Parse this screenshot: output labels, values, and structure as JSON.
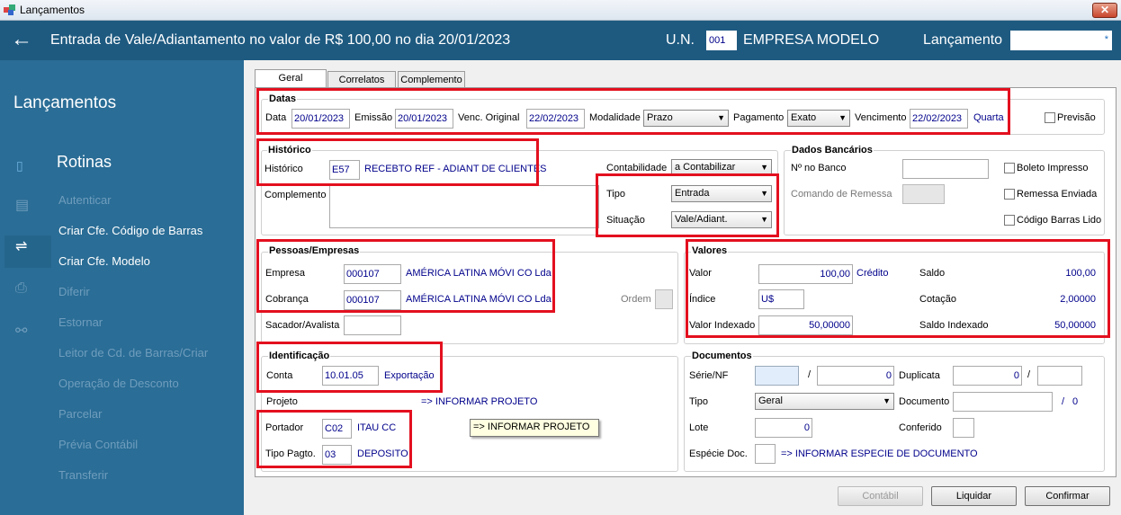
{
  "window": {
    "title": "Lançamentos",
    "close": "✕"
  },
  "header": {
    "back": "←",
    "title": "Entrada de Vale/Adiantamento no valor de R$ 100,00 no dia 20/01/2023",
    "un_label": "U.N.",
    "un_code": "001",
    "empresa": "EMPRESA MODELO",
    "lancamento_label": "Lançamento",
    "lancamento_value": "*"
  },
  "sidebar": {
    "title": "Lançamentos",
    "section": "Rotinas",
    "items": [
      {
        "label": "Autenticar",
        "enabled": false
      },
      {
        "label": "Criar Cfe. Código de Barras",
        "enabled": true
      },
      {
        "label": "Criar Cfe. Modelo",
        "enabled": true
      },
      {
        "label": "Diferir",
        "enabled": false
      },
      {
        "label": "Estornar",
        "enabled": false
      },
      {
        "label": "Leitor de Cd. de Barras/Criar",
        "enabled": false
      },
      {
        "label": "Operação de Desconto",
        "enabled": false
      },
      {
        "label": "Parcelar",
        "enabled": false
      },
      {
        "label": "Prévia Contábil",
        "enabled": false
      },
      {
        "label": "Transferir",
        "enabled": false
      }
    ]
  },
  "tabs": [
    "Geral",
    "Correlatos",
    "Complemento"
  ],
  "datas": {
    "title": "Datas",
    "data_label": "Data",
    "data": "20/01/2023",
    "emissao_label": "Emissão",
    "emissao": "20/01/2023",
    "venc_orig_label": "Venc. Original",
    "venc_orig": "22/02/2023",
    "modalidade_label": "Modalidade",
    "modalidade": "Prazo",
    "pagamento_label": "Pagamento",
    "pagamento": "Exato",
    "vencimento_label": "Vencimento",
    "vencimento": "22/02/2023",
    "dia_semana": "Quarta",
    "previsao_label": "Previsão"
  },
  "historico": {
    "title": "Histórico",
    "label": "Histórico",
    "code": "E57",
    "desc": "RECEBTO REF - ADIANT DE CLIENTES",
    "complemento_label": "Complemento",
    "contabilidade_label": "Contabilidade",
    "contabilidade": "a Contabilizar",
    "tipo_label": "Tipo",
    "tipo": "Entrada",
    "situacao_label": "Situação",
    "situacao": "Vale/Adiant."
  },
  "bancarios": {
    "title": "Dados Bancários",
    "nobanco_label": "Nº no Banco",
    "remessa_label": "Comando de Remessa",
    "boleto": "Boleto Impresso",
    "remessa_env": "Remessa Enviada",
    "codbarras": "Código Barras Lido"
  },
  "pessoas": {
    "title": "Pessoas/Empresas",
    "empresa_label": "Empresa",
    "empresa_code": "000107",
    "empresa_name": "AMÉRICA LATINA  MÓVI CO Lda",
    "cobranca_label": "Cobrança",
    "cobranca_code": "000107",
    "cobranca_name": "AMÉRICA LATINA  MÓVI CO Lda",
    "ordem_label": "Ordem",
    "sacador_label": "Sacador/Avalista"
  },
  "valores": {
    "title": "Valores",
    "valor_label": "Valor",
    "valor": "100,00",
    "credito": "Crédito",
    "saldo_label": "Saldo",
    "saldo": "100,00",
    "indice_label": "Índice",
    "indice": "U$",
    "cotacao_label": "Cotação",
    "cotacao": "2,00000",
    "valor_idx_label": "Valor Indexado",
    "valor_idx": "50,00000",
    "saldo_idx_label": "Saldo Indexado",
    "saldo_idx": "50,00000"
  },
  "identificacao": {
    "title": "Identificação",
    "conta_label": "Conta",
    "conta": "10.01.05",
    "conta_desc": "Exportação",
    "projeto_label": "Projeto",
    "projeto_hint": "=> INFORMAR PROJETO",
    "portador_label": "Portador",
    "portador": "C02",
    "portador_desc": "ITAU CC",
    "tipopag_label": "Tipo Pagto.",
    "tipopag": "03",
    "tipopag_desc": "DEPOSITO"
  },
  "tooltip": "=> INFORMAR PROJETO",
  "documentos": {
    "title": "Documentos",
    "serie_label": "Série/NF",
    "serie": "",
    "nf": "0",
    "duplicata_label": "Duplicata",
    "duplicata": "0",
    "duplicata2": "",
    "tipo_label": "Tipo",
    "tipo": "Geral",
    "documento_label": "Documento",
    "documento_num": "0",
    "lote_label": "Lote",
    "lote": "0",
    "conferido_label": "Conferido",
    "especie_label": "Espécie Doc.",
    "especie_hint": "=> INFORMAR ESPECIE DE DOCUMENTO"
  },
  "buttons": {
    "contabil": "Contábil",
    "liquidar": "Liquidar",
    "confirmar": "Confirmar"
  }
}
